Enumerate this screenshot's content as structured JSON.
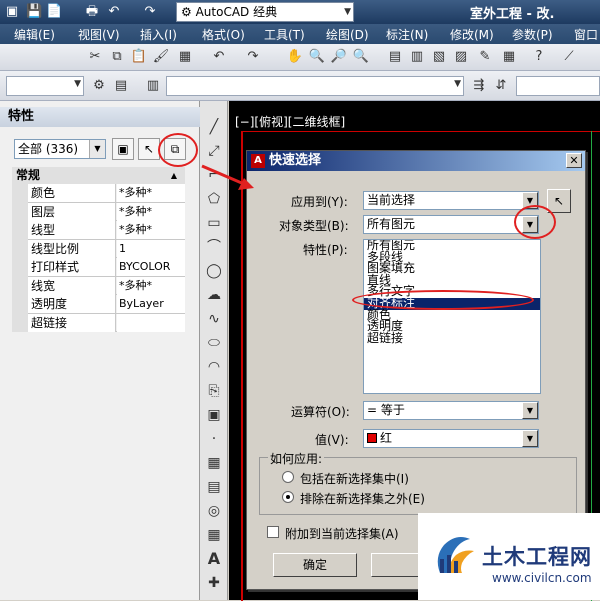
{
  "titlebar": {
    "workspace": "AutoCAD 经典",
    "title": "室外工程 - 改."
  },
  "menu": [
    "编辑(E)",
    "视图(V)",
    "插入(I)",
    "格式(O)",
    "工具(T)",
    "绘图(D)",
    "标注(N)",
    "修改(M)",
    "参数(P)",
    "窗口"
  ],
  "palette": {
    "title": "特性",
    "selection": "全部 (336)",
    "category": "常规",
    "rows": [
      {
        "name": "颜色",
        "value": "*多种*"
      },
      {
        "name": "图层",
        "value": "*多种*"
      },
      {
        "name": "线型",
        "value": "*多种*"
      },
      {
        "name": "线型比例",
        "value": "1"
      },
      {
        "name": "打印样式",
        "value": "BYCOLOR"
      },
      {
        "name": "线宽",
        "value": "*多种*"
      },
      {
        "name": "透明度",
        "value": "ByLayer"
      },
      {
        "name": "超链接",
        "value": ""
      }
    ]
  },
  "canvas": {
    "view_label": "[−][俯视][二维线框]"
  },
  "dialog": {
    "title": "快速选择",
    "apply_to_label": "应用到(Y):",
    "apply_to_value": "当前选择",
    "object_type_label": "对象类型(B):",
    "object_type_value": "所有图元",
    "property_label": "特性(P):",
    "property_list": [
      "所有图元",
      "多段线",
      "图案填充",
      "直线",
      "多行文字",
      "对齐标注",
      "颜色",
      "透明度",
      "超链接"
    ],
    "selected_index": 5,
    "operator_label": "运算符(O):",
    "operator_value": "= 等于",
    "value_label": "值(V):",
    "value_value": "红",
    "value_color": "#e00000",
    "how_apply_label": "如何应用:",
    "include_label": "包括在新选择集中(I)",
    "exclude_label": "排除在新选择集之外(E)",
    "exclude_selected": true,
    "append_label": "附加到当前选择集(A)",
    "ok_label": "确定",
    "cancel_label": "取"
  },
  "watermark": {
    "name": "土木工程网",
    "url": "www.civilcn.com"
  },
  "colors": {
    "annotation": "#e02020",
    "titlebar": "#1d3a60"
  }
}
